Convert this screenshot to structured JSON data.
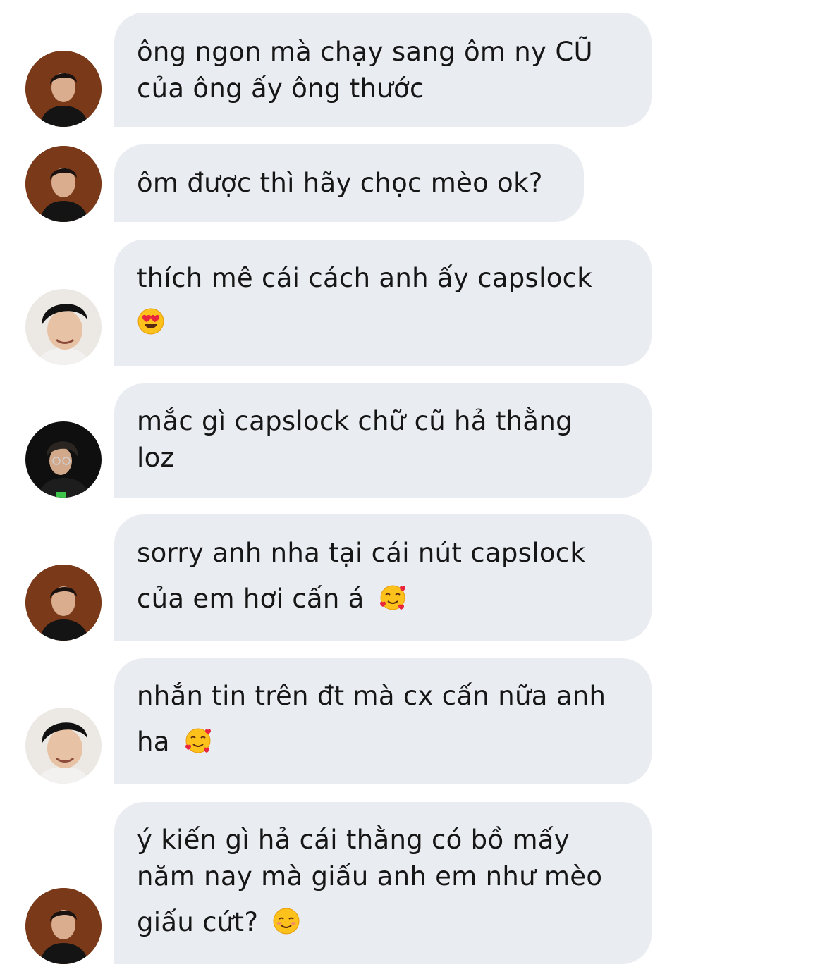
{
  "conversation": {
    "messages": [
      {
        "avatar": "avatar-dark-brown",
        "lines": [
          "ông ngon mà chạy sang ôm ny CŨ",
          "của ông ấy ông thước"
        ]
      },
      {
        "avatar": "avatar-dark-brown",
        "lines": [
          "ôm được thì hãy chọc mèo ok?"
        ]
      },
      {
        "avatar": "avatar-light-smiling",
        "lines": [
          "thích mê cái cách anh ấy capslock",
          ""
        ],
        "emoji": "heart-eyes-emoji"
      },
      {
        "avatar": "avatar-dark-glasses",
        "lines": [
          "mắc gì capslock chữ cũ hả thằng",
          "loz"
        ]
      },
      {
        "avatar": "avatar-dark-brown",
        "lines": [
          "sorry anh nha tại cái nút capslock",
          "của em hơi cấn á"
        ],
        "emoji": "smiling-hearts-emoji"
      },
      {
        "avatar": "avatar-light-smiling",
        "lines": [
          "nhắn tin trên đt mà cx cấn nữa anh",
          "ha"
        ],
        "emoji": "smiling-hearts-emoji"
      },
      {
        "avatar": "avatar-dark-brown",
        "lines": [
          "ý kiến gì hả cái thằng có bồ mấy",
          "năm nay mà giấu anh em như mèo",
          "giấu cứt?"
        ],
        "emoji": "smiling-blush-emoji"
      }
    ]
  },
  "colors": {
    "bubble_background": "#e9ecf1",
    "text": "#161616",
    "page_background": "#ffffff"
  }
}
